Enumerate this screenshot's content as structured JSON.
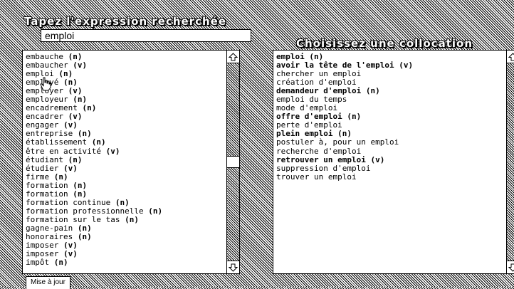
{
  "search": {
    "title": "Tapez l'expression recherchée",
    "value": "emploi"
  },
  "collocations": {
    "title": "Choisissez une collocation",
    "items": [
      {
        "text": "emploi",
        "pos": "(n)",
        "bold": true
      },
      {
        "text": "avoir la tête de l'emploi",
        "pos": "(v)",
        "bold": true
      },
      {
        "text": "chercher un emploi",
        "pos": "",
        "bold": false
      },
      {
        "text": "création d'emploi",
        "pos": "",
        "bold": false
      },
      {
        "text": "demandeur d'emploi",
        "pos": "(n)",
        "bold": true
      },
      {
        "text": "emploi du temps",
        "pos": "",
        "bold": false
      },
      {
        "text": "mode d'emploi",
        "pos": "",
        "bold": false
      },
      {
        "text": "offre d'emploi",
        "pos": "(n)",
        "bold": true
      },
      {
        "text": "perte d'emploi",
        "pos": "",
        "bold": false
      },
      {
        "text": "plein emploi",
        "pos": "(n)",
        "bold": true
      },
      {
        "text": "postuler à, pour un emploi",
        "pos": "",
        "bold": false
      },
      {
        "text": "recherche d'emploi",
        "pos": "",
        "bold": false
      },
      {
        "text": "retrouver un emploi",
        "pos": "(v)",
        "bold": true
      },
      {
        "text": "suppression d'emploi",
        "pos": "",
        "bold": false
      },
      {
        "text": "trouver un emploi",
        "pos": "",
        "bold": false
      }
    ]
  },
  "words": {
    "items": [
      {
        "text": "embauche",
        "pos": "(n)"
      },
      {
        "text": "embaucher",
        "pos": "(v)"
      },
      {
        "text": "emploi",
        "pos": "(n)"
      },
      {
        "text": "employé",
        "pos": "(n)"
      },
      {
        "text": "employer",
        "pos": "(v)"
      },
      {
        "text": "employeur",
        "pos": "(n)"
      },
      {
        "text": "encadrement",
        "pos": "(n)"
      },
      {
        "text": "encadrer",
        "pos": "(v)"
      },
      {
        "text": "engager",
        "pos": "(v)"
      },
      {
        "text": "entreprise",
        "pos": "(n)"
      },
      {
        "text": "établissement",
        "pos": "(n)"
      },
      {
        "text": "être en activité",
        "pos": "(v)"
      },
      {
        "text": "étudiant",
        "pos": "(n)"
      },
      {
        "text": "étudier",
        "pos": "(v)"
      },
      {
        "text": "firme",
        "pos": "(n)"
      },
      {
        "text": "formation",
        "pos": "(n)"
      },
      {
        "text": "formation",
        "pos": "(n)"
      },
      {
        "text": "formation continue",
        "pos": "(n)"
      },
      {
        "text": "formation professionnelle",
        "pos": "(n)"
      },
      {
        "text": "formation sur le tas",
        "pos": "(n)"
      },
      {
        "text": "gagne-pain",
        "pos": "(n)"
      },
      {
        "text": "honoraires",
        "pos": "(n)"
      },
      {
        "text": "imposer",
        "pos": "(v)"
      },
      {
        "text": "imposer",
        "pos": "(v)"
      },
      {
        "text": "impôt",
        "pos": "(n)"
      }
    ],
    "scroll_fraction": 0.5
  },
  "update_button": {
    "label": "Mise à jour"
  },
  "icons": {
    "scroll_up": "scroll-up-arrow-icon",
    "scroll_down": "scroll-down-arrow-icon",
    "cursor": "hand-cursor-icon"
  }
}
